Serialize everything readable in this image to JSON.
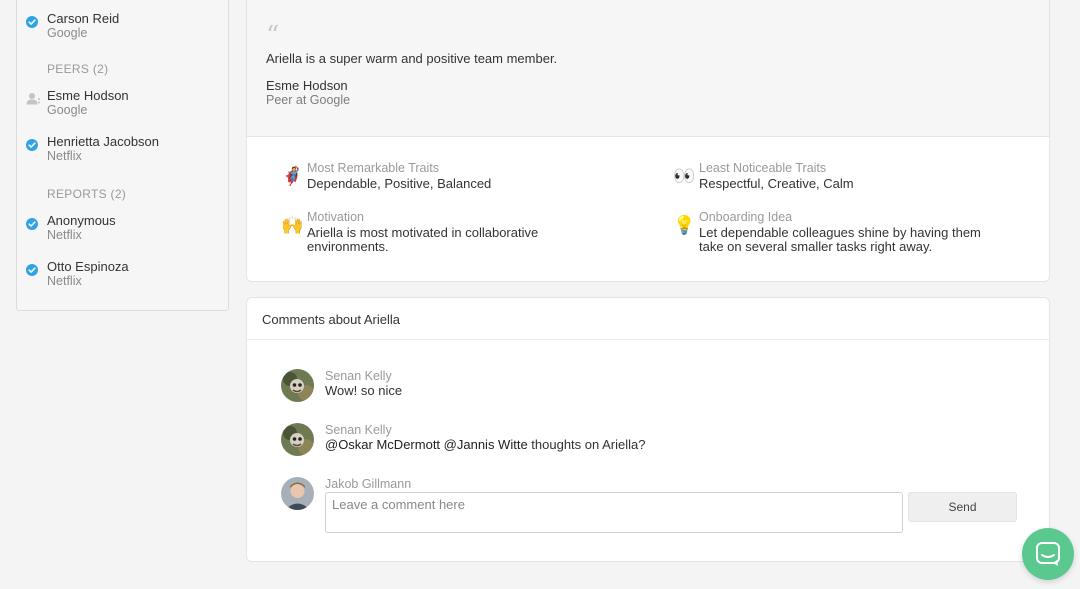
{
  "sidebar": {
    "top_person": {
      "name": "Carson Reid",
      "company": "Google"
    },
    "peers_label": "PEERS (2)",
    "peers": [
      {
        "name": "Esme Hodson",
        "company": "Google",
        "status_icon": "user-pending-icon"
      },
      {
        "name": "Henrietta Jacobson",
        "company": "Netflix",
        "status_icon": "check-circle-icon"
      }
    ],
    "reports_label": "REPORTS (2)",
    "reports": [
      {
        "name": "Anonymous",
        "company": "Netflix",
        "status_icon": "check-circle-icon"
      },
      {
        "name": "Otto Espinoza",
        "company": "Netflix",
        "status_icon": "check-circle-icon"
      }
    ]
  },
  "review": {
    "quote_mark": "“",
    "quote": "Ariella is a super warm and positive team member.",
    "author": "Esme Hodson",
    "role": "Peer at Google",
    "traits": [
      {
        "emoji": "🦸",
        "label": "Most Remarkable Traits",
        "value": "Dependable, Positive, Balanced"
      },
      {
        "emoji": "👀",
        "label": "Least Noticeable Traits",
        "value": "Respectful, Creative, Calm"
      },
      {
        "emoji": "🙌",
        "label": "Motivation",
        "value": "Ariella is most motivated in collaborative environments."
      },
      {
        "emoji": "💡",
        "label": "Onboarding Idea",
        "value": "Let dependable colleagues shine by having them take on several smaller tasks right away."
      }
    ]
  },
  "comments": {
    "title": "Comments about Ariella",
    "items": [
      {
        "author": "Senan Kelly",
        "text": "Wow! so nice"
      },
      {
        "author": "Senan Kelly",
        "mention1": "@Oskar McDermott",
        "mention2": "@Jannis Witte",
        "text_tail": " thoughts on Ariella?"
      }
    ],
    "composer": {
      "author": "Jakob Gillmann",
      "placeholder": "Leave a comment here",
      "value": "",
      "send_label": "Send"
    }
  },
  "colors": {
    "accent": "#2fa3e6",
    "chat": "#5bc98f"
  }
}
